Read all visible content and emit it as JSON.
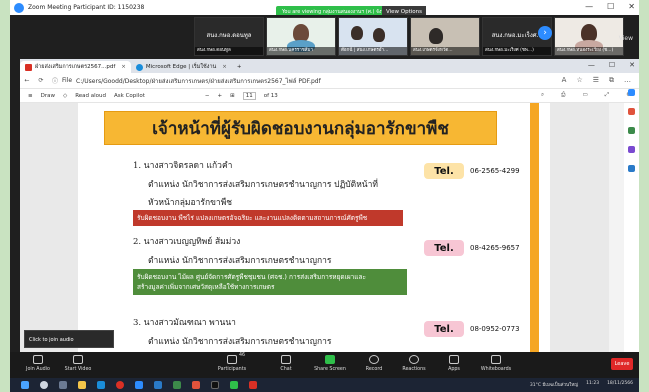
{
  "zoom": {
    "title": "Zoom Meeting Participant ID: 1150238",
    "share_banner": "You are viewing กลุ่มงานสนองงานฯ (ศ.) จังหวัด ... screen",
    "view_options": "View Options",
    "view": "View",
    "window_controls": [
      "—",
      "☐",
      "✕"
    ]
  },
  "tiles": [
    {
      "big": "สนง.กษอ.ดอนทูล",
      "name": "สนง.กษอ.ดอนทูล"
    },
    {
      "big": "",
      "name": "สนง.กษอ.นครราชสีมา"
    },
    {
      "big": "",
      "name": "ต๊อกฉี | สนง.เกษตรอำ..."
    },
    {
      "big": "",
      "name": "สนง.เกษตรจังหวัด..."
    },
    {
      "big": "สนง.กษอ.มะเร็งศ...",
      "name": "สนง.กษอ.มะเร็งศ (ชพ...)"
    },
    {
      "big": "",
      "name": "สนง.กษอ.หนองระเวียง (ช...)"
    }
  ],
  "browser": {
    "tabs": [
      {
        "label": "ฝ่ายส่งเสริมการเกษตร2567...pdf",
        "active": true
      },
      {
        "label": "Microsoft Edge | เริ่มใช้งาน",
        "active": false
      }
    ],
    "new_tab": "+",
    "url": "C:/Users/Goodd/Desktop/ฝ่ายส่งเสริมการเกษตร/ฝ่ายส่งเสริมการเกษตร2567_ไฟล์ PDF.pdf",
    "file_label": "File",
    "pdf_toolbar": {
      "draw": "Draw",
      "read_aloud": "Read aloud",
      "ask_copilot": "Ask Copilot",
      "page_current": "11",
      "page_total": "of 13"
    }
  },
  "document": {
    "heading": "เจ้าหน้าที่ผู้รับผิดชอบงานกลุ่มอารักขาพืช",
    "entries": [
      {
        "name": "1. นางสาวจิตรลดา แก้วคำ",
        "position": "ตำแหน่ง นักวิชาการส่งเสริมการเกษตรชำนาญการ ปฏิบัติหน้าที่",
        "position2": "หัวหน้ากลุ่มอารักขาพืช",
        "tel_label": "Tel.",
        "tel": "06-2565-4299",
        "resp": [
          "รับผิดชอบงาน พืชไร่ แปลงเกษตรอัจฉริยะ และงานแปลงติดตามสถานการณ์ศัตรูพืช"
        ]
      },
      {
        "name": "2. นางสาวเบญญทิพย์ ส้มม่วง",
        "position": "ตำแหน่ง นักวิชาการส่งเสริมการเกษตรชำนาญการ",
        "tel_label": "Tel.",
        "tel": "08-4265-9657",
        "resp": [
          "รับผิดชอบงาน ไม้ผล ศูนย์จัดการศัตรูพืชชุมชน (ศจช.) การส่งเสริมการหยุดเผาและ",
          "สร้างมูลค่าเพิ่มจากเศษวัสดุเหลือใช้ทางการเกษตร"
        ]
      },
      {
        "name": "3. นางสาวมัณฑณา พานนา",
        "position": "ตำแหน่ง นักวิชาการส่งเสริมการเกษตรชำนาญการ",
        "tel_label": "Tel.",
        "tel": "08-0952-0773"
      }
    ]
  },
  "controls": {
    "join_audio": "Join Audio",
    "start_video": "Start Video",
    "participants": "Participants",
    "participants_count": "46",
    "chat": "Chat",
    "share_screen": "Share Screen",
    "record": "Record",
    "reactions": "Reactions",
    "apps": "Apps",
    "whiteboards": "Whiteboards",
    "leave": "Leave",
    "tooltip": "Click to join audio"
  },
  "taskbar": {
    "weather": "31°C มีเมฆเป็นส่วนใหญ่",
    "time": "11:23",
    "date": "18/11/2566"
  }
}
